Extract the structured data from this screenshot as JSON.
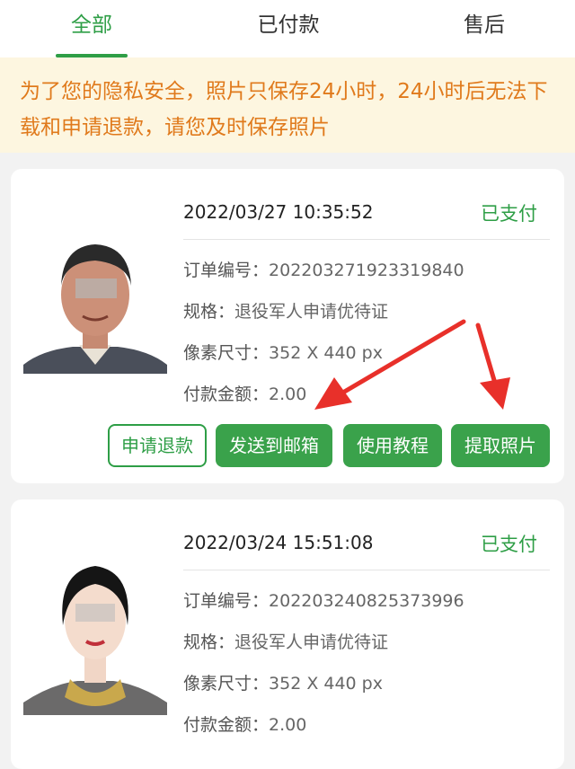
{
  "tabs": [
    {
      "label": "全部",
      "active": true
    },
    {
      "label": "已付款",
      "active": false
    },
    {
      "label": "售后",
      "active": false
    }
  ],
  "notice": {
    "line1": "为了您的隐私安全，照片只保存24小时，24小时后无法下",
    "line2": "载和申请退款，请您及时保存照片"
  },
  "orders": [
    {
      "datetime": "2022/03/27 10:35:52",
      "status": "已支付",
      "order_no_label": "订单编号：",
      "order_no": "20220327192331984​0",
      "spec_label": "规格：",
      "spec": "退役军人申请优待证",
      "size_label": "像素尺寸：",
      "size": "352 X 440 px",
      "amount_label": "付款金额：",
      "amount": "2.00",
      "buttons": {
        "refund": "申请退款",
        "email": "发送到邮箱",
        "tutorial": "使用教程",
        "extract": "提取照片"
      }
    },
    {
      "datetime": "2022/03/24 15:51:08",
      "status": "已支付",
      "order_no_label": "订单编号：",
      "order_no": "202203240825373996",
      "spec_label": "规格：",
      "spec": "退役军人申请优待证",
      "size_label": "像素尺寸：",
      "size": "352 X 440 px",
      "amount_label": "付款金额：",
      "amount": "2.00"
    }
  ],
  "colors": {
    "accent": "#2e9e46",
    "notice_text": "#e07a1c",
    "notice_bg": "#fdf6e0",
    "arrow": "#e8302a"
  }
}
